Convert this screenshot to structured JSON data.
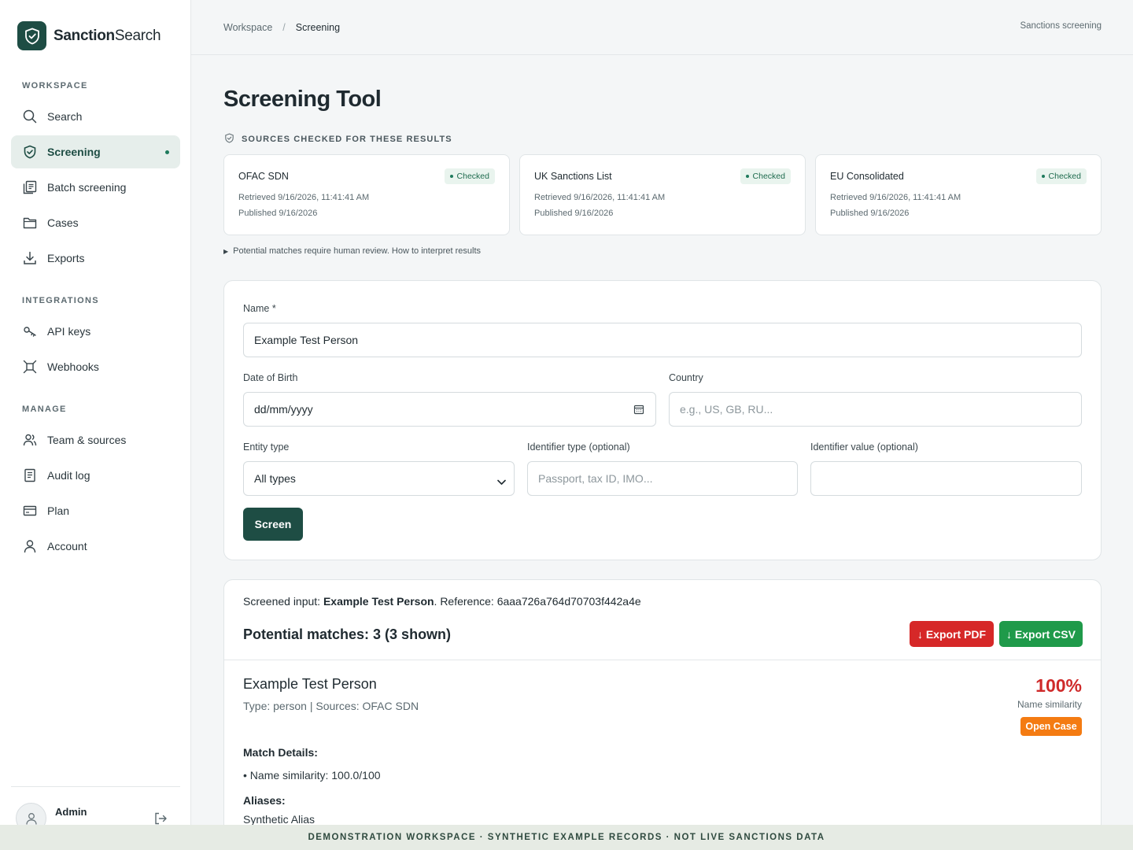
{
  "brand": {
    "name_bold": "Sanction",
    "name_rest": "Search"
  },
  "sidebar": {
    "sections": [
      {
        "label": "WORKSPACE"
      },
      {
        "label": "INTEGRATIONS"
      },
      {
        "label": "MANAGE"
      }
    ],
    "items": [
      {
        "label": "Search",
        "icon": "search-icon"
      },
      {
        "label": "Screening",
        "icon": "shield-check-icon",
        "active": true
      },
      {
        "label": "Batch screening",
        "icon": "stack-icon"
      },
      {
        "label": "Cases",
        "icon": "folder-icon"
      },
      {
        "label": "Exports",
        "icon": "download-icon"
      },
      {
        "label": "API keys",
        "icon": "key-icon"
      },
      {
        "label": "Webhooks",
        "icon": "webhook-icon"
      },
      {
        "label": "Team & sources",
        "icon": "users-icon"
      },
      {
        "label": "Audit log",
        "icon": "document-icon"
      },
      {
        "label": "Plan",
        "icon": "credit-card-icon"
      },
      {
        "label": "Account",
        "icon": "user-icon"
      }
    ],
    "user": {
      "name": "Admin"
    }
  },
  "topbar": {
    "breadcrumb": [
      "Workspace",
      "Screening"
    ],
    "right_label": "Sanctions screening"
  },
  "main": {
    "title": "Screening Tool",
    "sources_label": "SOURCES CHECKED FOR THESE RESULTS",
    "sources": [
      {
        "name": "OFAC SDN",
        "status": "Checked",
        "retrieved": "Retrieved 9/16/2026, 11:41:41 AM",
        "published": "Published 9/16/2026"
      },
      {
        "name": "UK Sanctions List",
        "status": "Checked",
        "retrieved": "Retrieved 9/16/2026, 11:41:41 AM",
        "published": "Published 9/16/2026"
      },
      {
        "name": "EU Consolidated",
        "status": "Checked",
        "retrieved": "Retrieved 9/16/2026, 11:41:41 AM",
        "published": "Published 9/16/2026"
      }
    ],
    "interpret_text": "Potential matches require human review. How to interpret results"
  },
  "form": {
    "name_label": "Name *",
    "name_value": "Example Test Person",
    "dob_label": "Date of Birth",
    "dob_placeholder": "dd/mm/yyyy",
    "country_label": "Country",
    "country_placeholder": "e.g., US, GB, RU...",
    "entity_label": "Entity type",
    "entity_value": "All types",
    "id_type_label": "Identifier type (optional)",
    "id_type_placeholder": "Passport, tax ID, IMO...",
    "id_value_label": "Identifier value (optional)",
    "id_value_value": "",
    "submit_label": "Screen"
  },
  "results": {
    "screened_prefix": "Screened input: ",
    "screened_name": "Example Test Person",
    "reference_text": ". Reference: 6aaa726a764d70703f442a4e",
    "matches_title": "Potential matches: 3 (3 shown)",
    "export_pdf": "↓ Export PDF",
    "export_csv": "↓ Export CSV",
    "match": {
      "name": "Example Test Person",
      "meta": "Type: person | Sources: OFAC SDN",
      "score": "100%",
      "score_label": "Name similarity",
      "open_case": "Open Case",
      "details_title": "Match Details:",
      "details_line": "• Name similarity: 100.0/100",
      "aliases_title": "Aliases:",
      "alias": "Synthetic Alias"
    }
  },
  "banner": "DEMONSTRATION WORKSPACE · SYNTHETIC EXAMPLE RECORDS · NOT LIVE SANCTIONS DATA",
  "colors": {
    "brand": "#1e4d44",
    "danger": "#d62828",
    "success": "#1f9a4a",
    "warning": "#f47b12"
  }
}
